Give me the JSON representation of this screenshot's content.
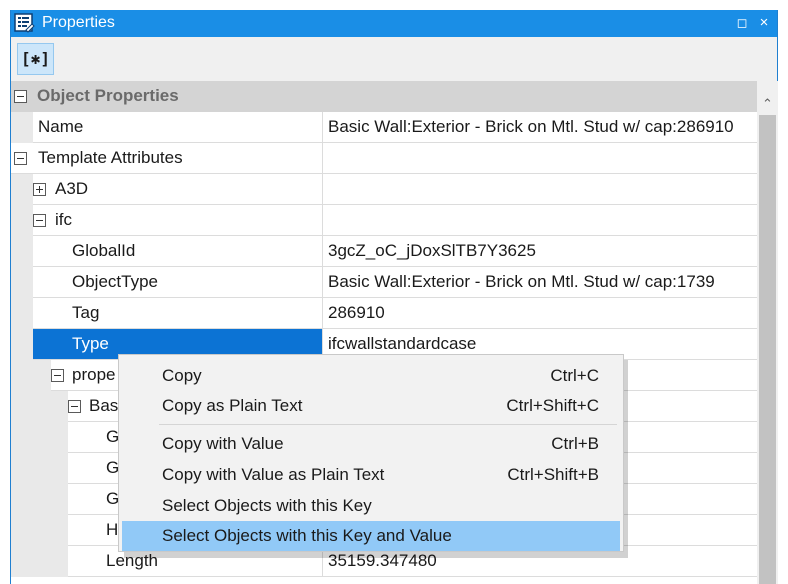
{
  "window": {
    "title": "Properties",
    "icon": "properties-list-icon",
    "restore_glyph": "◻",
    "close_glyph": "×",
    "accent": "#1a8ee6"
  },
  "toolbar": {
    "toggle_label": "[✱]"
  },
  "grid": {
    "category": "Object Properties",
    "rows": [
      {
        "name": "Name",
        "value": "Basic Wall:Exterior - Brick on Mtl. Stud w/ cap:286910"
      },
      {
        "name": "Template Attributes",
        "value": ""
      },
      {
        "name": "A3D",
        "value": ""
      },
      {
        "name": "ifc",
        "value": ""
      },
      {
        "name": "GlobalId",
        "value": "3gcZ_oC_jDoxSlTB7Y3625"
      },
      {
        "name": "ObjectType",
        "value": "Basic Wall:Exterior - Brick on Mtl. Stud w/ cap:1739"
      },
      {
        "name": "Tag",
        "value": "286910"
      },
      {
        "name": "Type",
        "value": "ifcwallstandardcase"
      },
      {
        "name": "prope",
        "value": ""
      },
      {
        "name": "Base",
        "value": ""
      },
      {
        "name": "G",
        "value": ""
      },
      {
        "name": "G",
        "value": ""
      },
      {
        "name": "G",
        "value": ""
      },
      {
        "name": "H",
        "value": ""
      },
      {
        "name": "Length",
        "value": "35159.347480"
      }
    ],
    "selected_color": "#0c73d4"
  },
  "context_menu": {
    "items": [
      {
        "label": "Copy",
        "shortcut": "Ctrl+C"
      },
      {
        "label": "Copy as Plain Text",
        "shortcut": "Ctrl+Shift+C"
      },
      {
        "label": "Copy with Value",
        "shortcut": "Ctrl+B"
      },
      {
        "label": "Copy with Value as Plain Text",
        "shortcut": "Ctrl+Shift+B"
      },
      {
        "label": "Select Objects with this Key",
        "shortcut": ""
      },
      {
        "label": "Select Objects with this Key and Value",
        "shortcut": ""
      }
    ],
    "highlight_color": "#91c9f7"
  },
  "scrollbar": {
    "up_glyph": "⌃"
  }
}
